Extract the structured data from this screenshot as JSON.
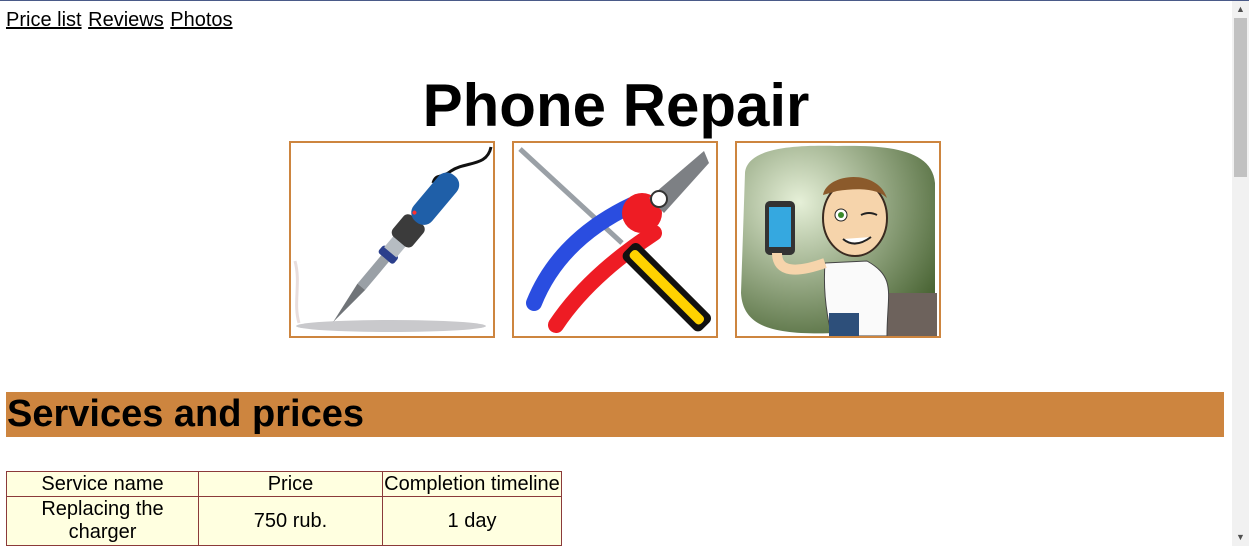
{
  "nav": {
    "links": [
      "Price list",
      "Reviews",
      "Photos"
    ]
  },
  "header": {
    "title": "Phone Repair"
  },
  "gallery": {
    "images": [
      "soldering-iron",
      "tools-pliers-screwdriver",
      "man-with-phone"
    ]
  },
  "services": {
    "heading": "Services and prices",
    "columns": [
      "Service name",
      "Price",
      "Completion timeline"
    ],
    "rows": [
      [
        "Replacing the charger",
        "750 rub.",
        "1 day"
      ]
    ]
  },
  "colors": {
    "accent": "#cd853f",
    "table_bg": "#ffffe0",
    "table_border": "#8b3a3a"
  }
}
